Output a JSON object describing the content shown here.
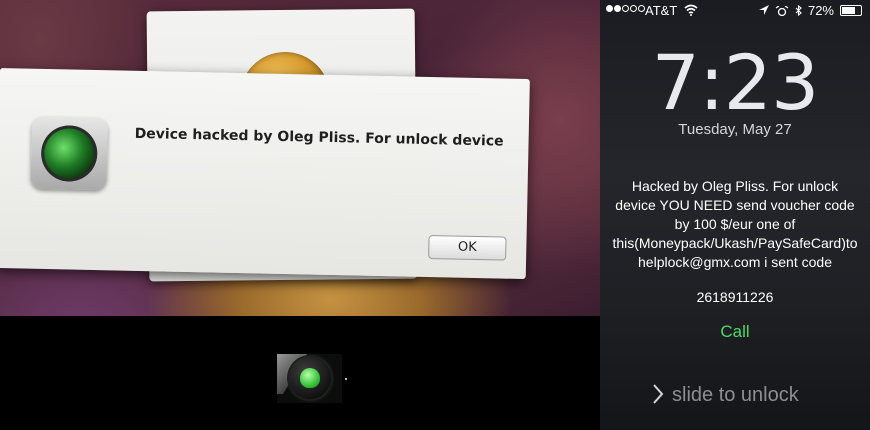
{
  "left_photo": {
    "dialog": {
      "message": "Device hacked by Oleg Pliss. For unlock device",
      "ok_label": "OK"
    },
    "coin_glyph": "1"
  },
  "lock_screen": {
    "status_bar": {
      "carrier": "AT&T",
      "battery": "72%",
      "battery_level": 0.72
    },
    "time": "7:23",
    "date": "Tuesday, May 27",
    "notification": "Hacked by Oleg Pliss. For unlock device YOU NEED send voucher code by 100 $/eur one of this(Moneypack/Ukash/PaySafeCard)to helplock@gmx.com i sent code",
    "code": "2618911226",
    "call_label": "Call",
    "slide_label": "slide to unlock"
  },
  "colors": {
    "call_green": "#4cd964",
    "radar_green": "#1e7c24"
  }
}
